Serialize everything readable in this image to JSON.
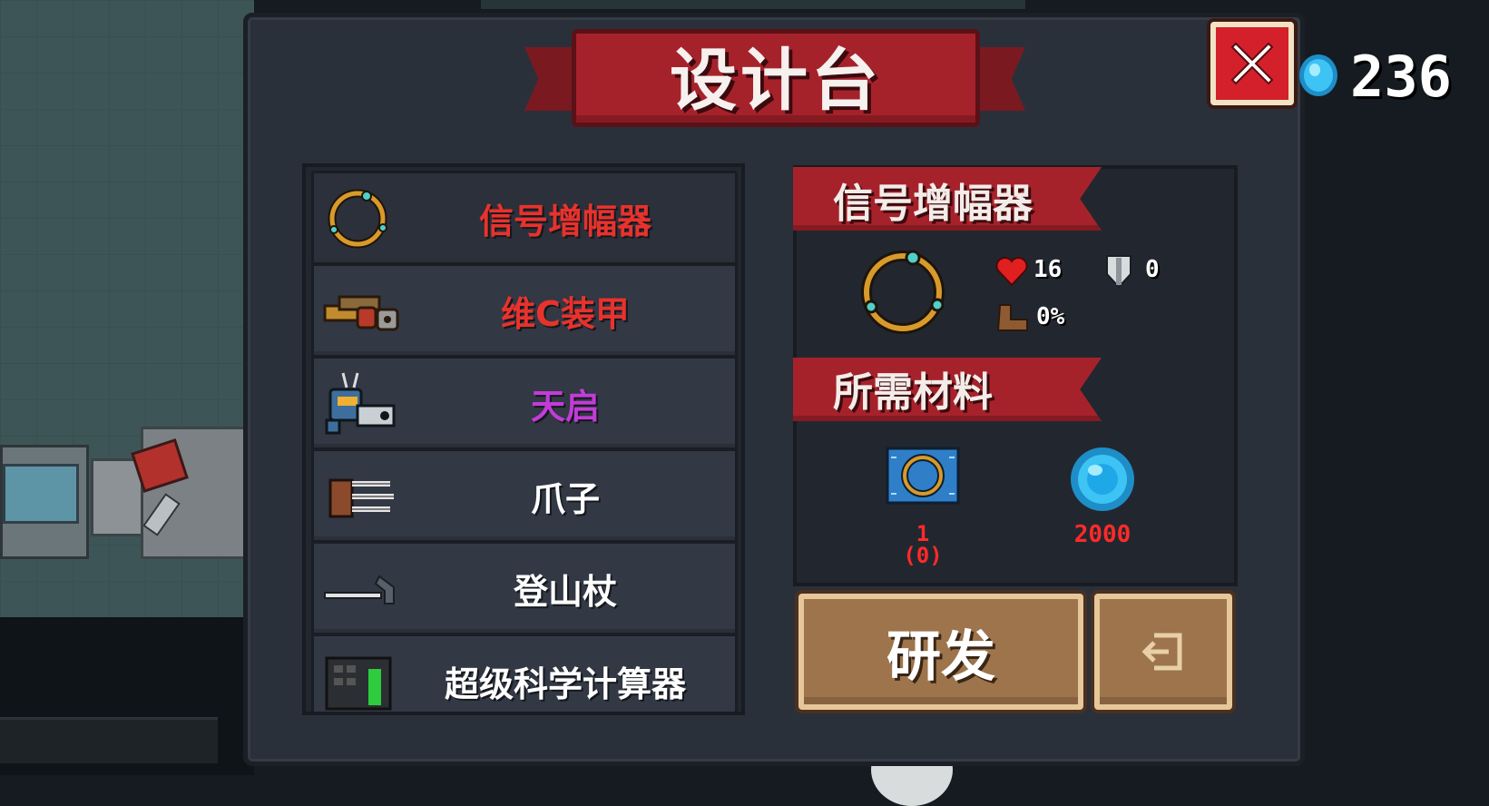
{
  "header": {
    "title": "设计台",
    "close_icon": "close-icon",
    "gem_count": "236"
  },
  "list": {
    "items": [
      {
        "label": "信号增幅器",
        "color": "#e8322d",
        "icon": "ring-icon",
        "selected": true
      },
      {
        "label": "维C装甲",
        "color": "#e8322d",
        "icon": "armor-icon"
      },
      {
        "label": "天启",
        "color": "#c23cd8",
        "icon": "mech-robot-icon"
      },
      {
        "label": "爪子",
        "color": "#ffffff",
        "icon": "claw-icon"
      },
      {
        "label": "登山杖",
        "color": "#ffffff",
        "icon": "hiking-stick-icon"
      },
      {
        "label": "超级科学计算器",
        "color": "#ffffff",
        "icon": "calculator-icon"
      }
    ]
  },
  "detail": {
    "name": "信号增幅器",
    "stats": {
      "health": "16",
      "armor": "0",
      "speed": "0%"
    },
    "materials_title": "所需材料",
    "materials": [
      {
        "icon": "blueprint-icon",
        "count": "1",
        "owned": "(0)"
      },
      {
        "icon": "gem-icon",
        "count": "2000"
      }
    ]
  },
  "actions": {
    "develop_label": "研发",
    "exit_icon": "exit-icon"
  },
  "colors": {
    "ribbon": "#a6222b",
    "panel": "#2a3039",
    "button": "#9d744c",
    "gem": "#3ec3f5"
  }
}
